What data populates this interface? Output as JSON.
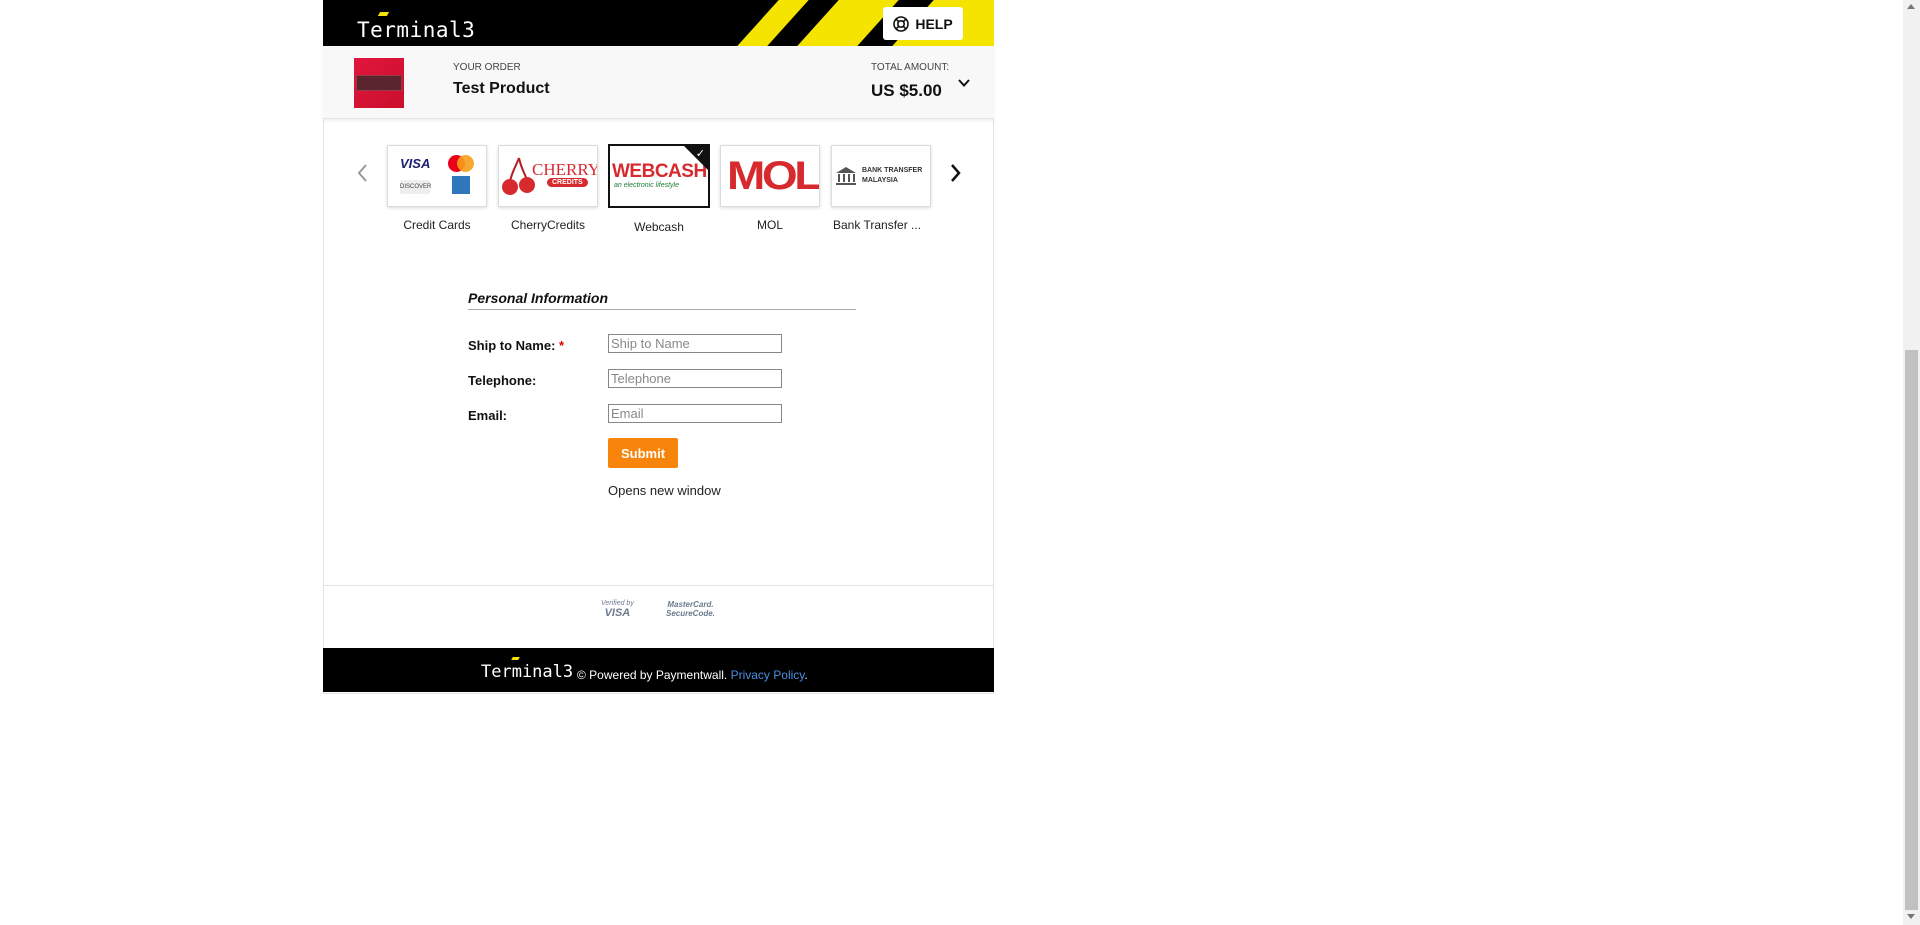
{
  "brand": {
    "name": "Terminal3",
    "accent": "#f5e400",
    "header_bg": "#000000"
  },
  "header": {
    "help_label": "HELP",
    "help_icon": "lifebuoy-icon"
  },
  "order": {
    "label": "YOUR ORDER",
    "product": "Test Product",
    "total_label": "TOTAL AMOUNT:",
    "total_amount": "US $5.00",
    "expand_icon": "chevron-down-icon"
  },
  "payment_methods": {
    "prev_icon": "chevron-left-icon",
    "next_icon": "chevron-right-icon",
    "selected": "Webcash",
    "items": [
      {
        "label": "Credit Cards"
      },
      {
        "label": "CherryCredits",
        "logo_text": "CHERRY",
        "logo_sub": "CREDITS"
      },
      {
        "label": "Webcash",
        "logo_text": "WEBCASH",
        "logo_sub": "an electronic lifestyle"
      },
      {
        "label": "MOL",
        "logo_text": "MOL"
      },
      {
        "label": "Bank Transfer ...",
        "logo_text": "BANK TRANSFER",
        "logo_sub": "MALAYSIA"
      }
    ],
    "card_logos": {
      "visa": "VISA",
      "discover": "DISCOVER",
      "mastercard": "MasterCard"
    }
  },
  "form": {
    "section_title": "Personal Information",
    "fields": [
      {
        "label": "Ship to Name:",
        "required_mark": "*",
        "placeholder": "Ship to Name",
        "value": ""
      },
      {
        "label": "Telephone:",
        "placeholder": "Telephone",
        "value": ""
      },
      {
        "label": "Email:",
        "placeholder": "Email",
        "value": ""
      }
    ],
    "submit_label": "Submit",
    "submit_color": "#f7850b",
    "hint": "Opens new window"
  },
  "security_badges": {
    "visa_line1": "Verified by",
    "visa_line2": "VISA",
    "mc_line1": "MasterCard.",
    "mc_line2": "SecureCode."
  },
  "footer": {
    "logo": "Terminal3",
    "powered_text": "© Powered by Paymentwall.",
    "privacy_link": "Privacy Policy",
    "trailing": ".",
    "link_color": "#4a8fe0"
  }
}
